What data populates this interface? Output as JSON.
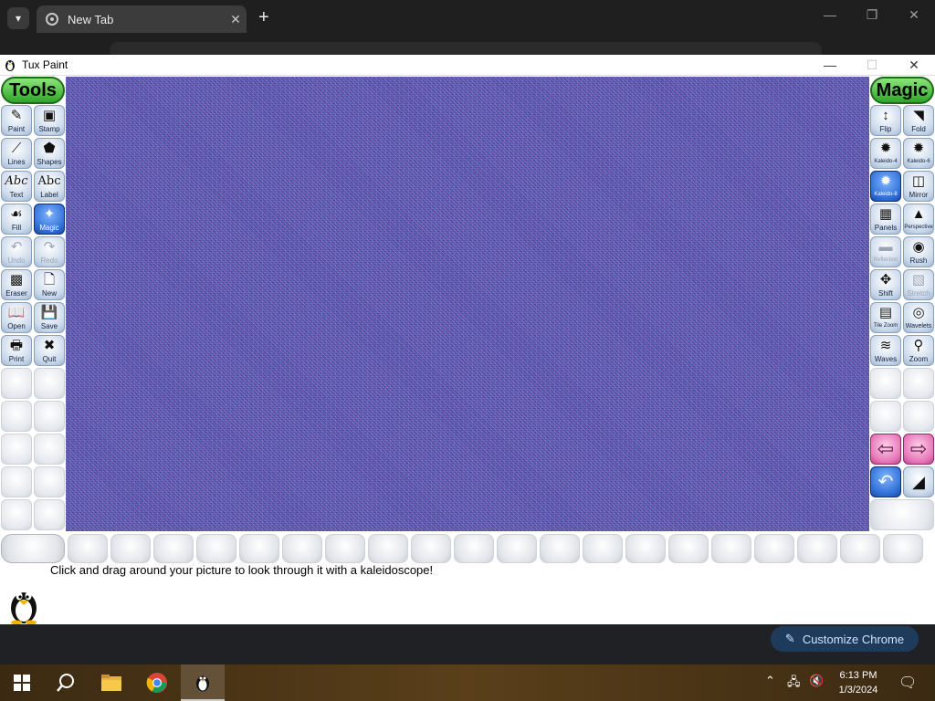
{
  "browser": {
    "tab_title": "New Tab",
    "new_tab_label": "+",
    "customize_label": "Customize Chrome"
  },
  "window": {
    "title": "Tux Paint"
  },
  "tools_panel": {
    "header": "Tools",
    "items": [
      {
        "label": "Paint",
        "icon": "paintbrush-icon"
      },
      {
        "label": "Stamp",
        "icon": "stamp-icon"
      },
      {
        "label": "Lines",
        "icon": "lines-icon"
      },
      {
        "label": "Shapes",
        "icon": "shapes-icon"
      },
      {
        "label": "Text",
        "icon": "text-icon"
      },
      {
        "label": "Label",
        "icon": "label-icon"
      },
      {
        "label": "Fill",
        "icon": "fill-bucket-icon"
      },
      {
        "label": "Magic",
        "icon": "magic-wand-icon",
        "selected": true
      },
      {
        "label": "Undo",
        "icon": "undo-icon",
        "disabled": true
      },
      {
        "label": "Redo",
        "icon": "redo-icon",
        "disabled": true
      },
      {
        "label": "Eraser",
        "icon": "eraser-icon"
      },
      {
        "label": "New",
        "icon": "new-document-icon"
      },
      {
        "label": "Open",
        "icon": "open-book-icon"
      },
      {
        "label": "Save",
        "icon": "save-icon"
      },
      {
        "label": "Print",
        "icon": "printer-icon"
      },
      {
        "label": "Quit",
        "icon": "quit-icon"
      }
    ]
  },
  "magic_panel": {
    "header": "Magic",
    "items": [
      {
        "label": "Flip",
        "icon": "flip-icon"
      },
      {
        "label": "Fold",
        "icon": "fold-icon"
      },
      {
        "label": "Kaleido-4",
        "icon": "kaleido4-icon"
      },
      {
        "label": "Kaleido-6",
        "icon": "kaleido6-icon"
      },
      {
        "label": "Kaleido-8",
        "icon": "kaleido8-icon",
        "selected": true
      },
      {
        "label": "Mirror",
        "icon": "mirror-icon"
      },
      {
        "label": "Panels",
        "icon": "panels-icon"
      },
      {
        "label": "Perspective",
        "icon": "perspective-icon"
      },
      {
        "label": "Reflection",
        "icon": "reflection-icon",
        "disabled": true
      },
      {
        "label": "Rush",
        "icon": "rush-icon"
      },
      {
        "label": "Shift",
        "icon": "shift-icon"
      },
      {
        "label": "Stretch",
        "icon": "stretch-icon"
      },
      {
        "label": "Tile Zoom",
        "icon": "tile-zoom-icon"
      },
      {
        "label": "Wavelets",
        "icon": "wavelets-icon"
      },
      {
        "label": "Waves",
        "icon": "waves-icon"
      },
      {
        "label": "Zoom",
        "icon": "zoom-icon"
      }
    ]
  },
  "status": {
    "instruction": "Click and drag around your picture to look through it with a kaleidoscope!"
  },
  "taskbar": {
    "time": "6:13 PM",
    "date": "1/3/2024"
  }
}
